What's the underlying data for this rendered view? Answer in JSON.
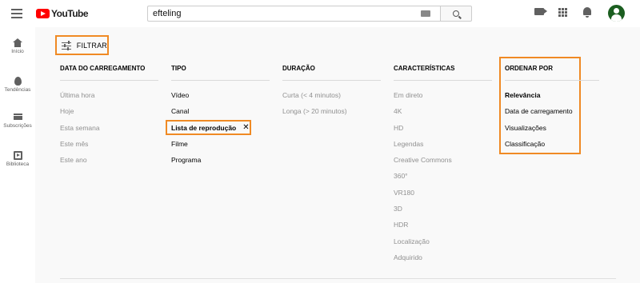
{
  "header": {
    "logo_text": "YouTube",
    "search_value": "efteling",
    "icons": [
      "menu-icon",
      "keyboard-icon",
      "search-icon",
      "create-video-icon",
      "apps-icon",
      "notifications-icon",
      "avatar"
    ]
  },
  "sidebar": {
    "items": [
      {
        "label": "Início",
        "icon": "home-icon"
      },
      {
        "label": "Tendências",
        "icon": "trending-icon"
      },
      {
        "label": "Subscrições",
        "icon": "subscriptions-icon"
      },
      {
        "label": "Biblioteca",
        "icon": "library-icon"
      }
    ]
  },
  "filter": {
    "button_label": "FILTRAR",
    "columns": [
      {
        "heading": "DATA DO CARREGAMENTO",
        "options": [
          "Última hora",
          "Hoje",
          "Esta semana",
          "Este mês",
          "Este ano"
        ]
      },
      {
        "heading": "TIPO",
        "options": [
          "Vídeo",
          "Canal",
          "Lista de reprodução",
          "Filme",
          "Programa"
        ],
        "selected": "Lista de reprodução"
      },
      {
        "heading": "DURAÇÃO",
        "options": [
          "Curta (< 4 minutos)",
          "Longa (> 20 minutos)"
        ]
      },
      {
        "heading": "CARACTERÍSTICAS",
        "options": [
          "Em direto",
          "4K",
          "HD",
          "Legendas",
          "Creative Commons",
          "360°",
          "VR180",
          "3D",
          "HDR",
          "Localização",
          "Adquirido"
        ]
      },
      {
        "heading": "ORDENAR POR",
        "options": [
          "Relevância",
          "Data de carregamento",
          "Visualizações",
          "Classificação"
        ],
        "selected": "Relevância"
      }
    ],
    "remove_symbol": "✕"
  },
  "colors": {
    "highlight": "#f08a24",
    "brand_red": "#ff0000",
    "muted_text": "#909090"
  }
}
